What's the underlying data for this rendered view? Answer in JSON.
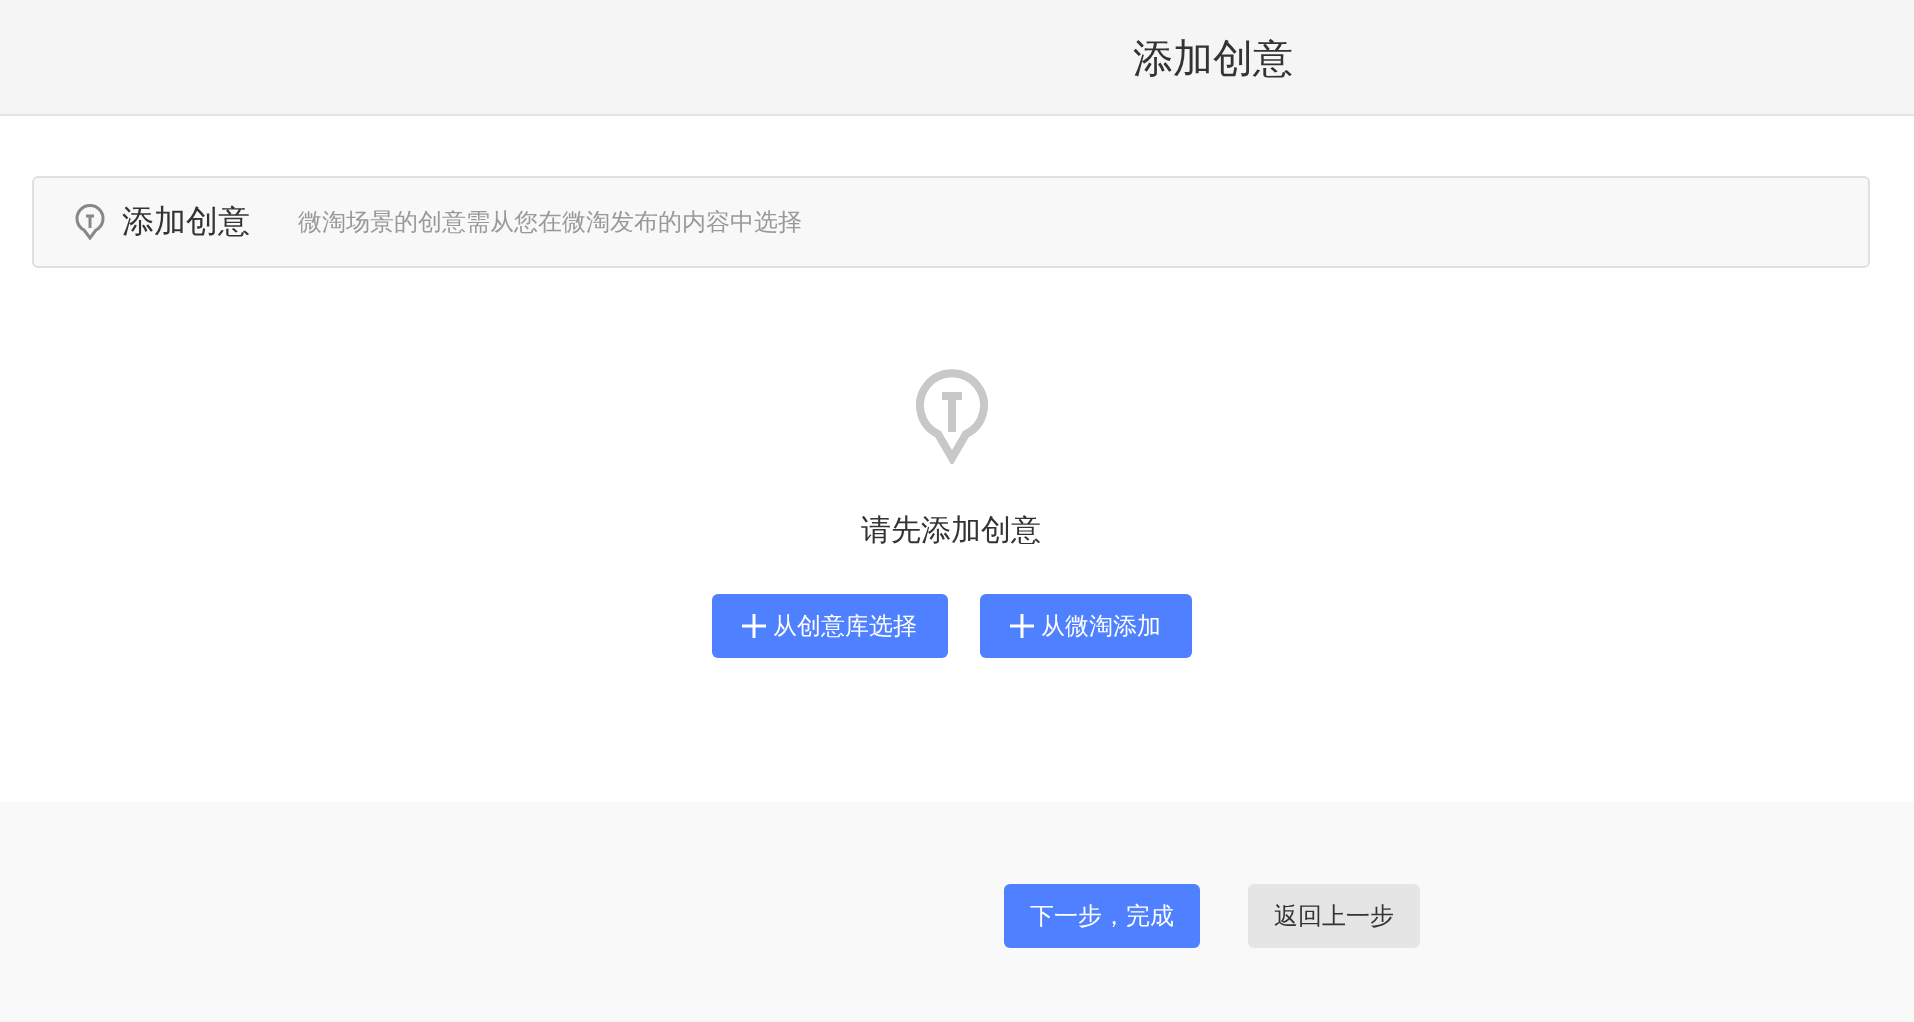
{
  "window": {
    "title": "添加创意"
  },
  "section": {
    "title": "添加创意",
    "hint": "微淘场景的创意需从您在微淘发布的内容中选择"
  },
  "empty_state": {
    "message": "请先添加创意",
    "buttons": [
      "从创意库选择",
      "从微淘添加"
    ]
  },
  "footer_buttons": [
    {
      "label": "下一步，完成",
      "kind": "primary"
    },
    {
      "label": "返回上一步",
      "kind": "secondary"
    }
  ]
}
